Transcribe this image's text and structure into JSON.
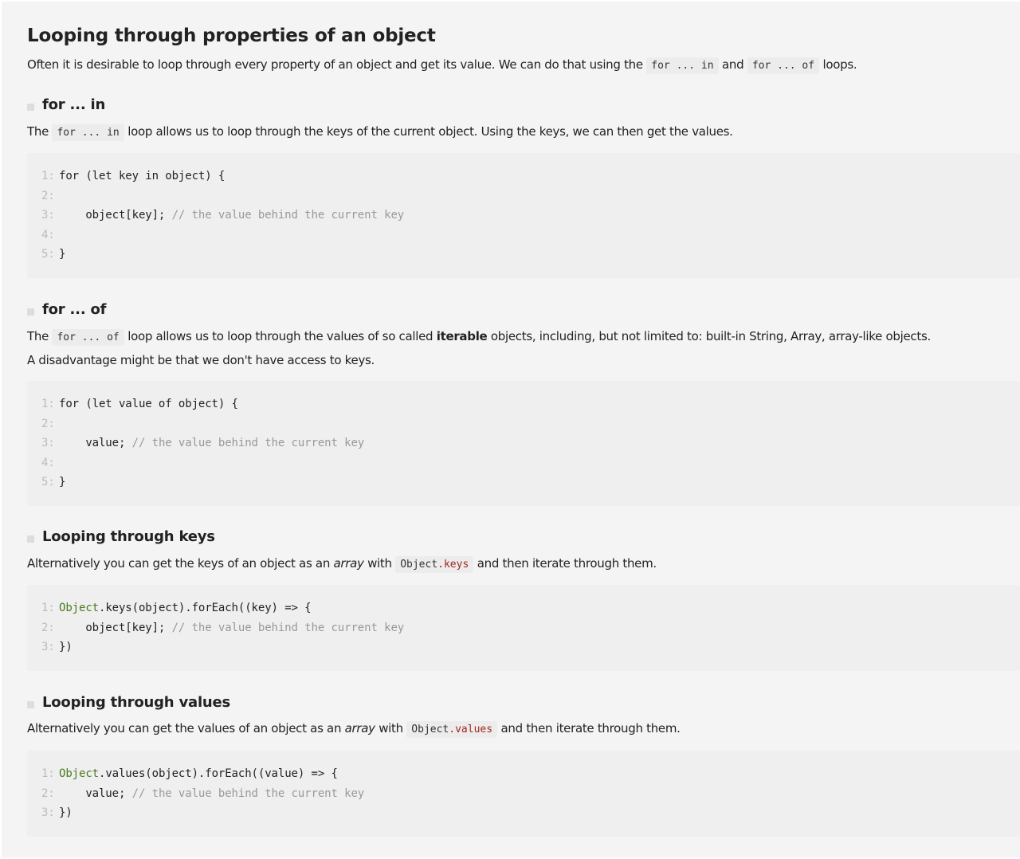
{
  "title": "Looping through properties of an object",
  "intro": {
    "before": "Often it is desirable to loop through every property of an object and get its value. We can do that using the ",
    "code1": "for ... in",
    "mid": " and ",
    "code2": "for ... of",
    "after": " loops."
  },
  "sections": [
    {
      "heading": "for ... in",
      "para": {
        "before": "The ",
        "code": "for ... in",
        "after": " loop allows us to loop through the keys of the current object. Using the keys, we can then get the values."
      },
      "code": [
        [
          {
            "t": "for (let key in object) {"
          }
        ],
        [],
        [
          {
            "t": "    object[key]; "
          },
          {
            "t": "// the value behind the current key",
            "c": "cm"
          }
        ],
        [],
        [
          {
            "t": "}"
          }
        ]
      ]
    },
    {
      "heading": "for ... of",
      "para": {
        "before": "The ",
        "code": "for ... of",
        "after": " loop allows us to loop through the values of so called ",
        "bold": "iterable",
        "after2": " objects, including, but not limited to: built-in String, Array, array-like objects.",
        "line2": "A disadvantage might be that we don't have access to keys."
      },
      "code": [
        [
          {
            "t": "for (let value of object) {"
          }
        ],
        [],
        [
          {
            "t": "    value; "
          },
          {
            "t": "// the value behind the current key",
            "c": "cm"
          }
        ],
        [],
        [
          {
            "t": "}"
          }
        ]
      ]
    },
    {
      "heading": "Looping through keys",
      "para": {
        "before": "Alternatively you can get the keys of an object as an ",
        "em": "array",
        "mid": " with ",
        "code_obj": "Object",
        "code_prop": ".keys",
        "after": " and then iterate through them."
      },
      "code": [
        [
          {
            "t": "Object",
            "c": "kw"
          },
          {
            "t": ".keys(object).forEach((key) => {"
          }
        ],
        [
          {
            "t": "    object[key]; "
          },
          {
            "t": "// the value behind the current key",
            "c": "cm"
          }
        ],
        [
          {
            "t": "})"
          }
        ]
      ]
    },
    {
      "heading": "Looping through values",
      "para": {
        "before": "Alternatively you can get the values of an object as an ",
        "em": "array",
        "mid": " with ",
        "code_obj": "Object",
        "code_prop": ".values",
        "after": " and then iterate through them."
      },
      "code": [
        [
          {
            "t": "Object",
            "c": "kw"
          },
          {
            "t": ".values(object).forEach((value) => {"
          }
        ],
        [
          {
            "t": "    value; "
          },
          {
            "t": "// the value behind the current key",
            "c": "cm"
          }
        ],
        [
          {
            "t": "})"
          }
        ]
      ]
    }
  ]
}
